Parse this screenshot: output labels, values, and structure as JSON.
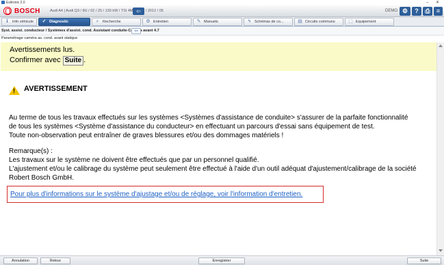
{
  "window": {
    "title": "Esitronic 2.0",
    "minimize_glyph": "–",
    "close_glyph": "✕"
  },
  "header": {
    "brand": "BOSCH",
    "vehicle_info": "Audi A4 | Audi Q3 / 8U / 02 / 25 / 130 kW / TSI 4M / 2019 / 2012 / 05",
    "back_glyph": "⇦",
    "demo_label": "DEMO",
    "buttons": [
      {
        "icon": "settings-icon",
        "glyph": "⚙"
      },
      {
        "icon": "help-icon",
        "glyph": "?"
      },
      {
        "icon": "print-icon",
        "glyph": "⎙"
      },
      {
        "icon": "menu-icon",
        "glyph": "≡"
      }
    ]
  },
  "tabs": [
    {
      "label": "Info véhicule",
      "icon": "info-icon",
      "glyph": "ℹ",
      "active": false
    },
    {
      "label": "Diagnostic",
      "icon": "diagnostic-icon",
      "glyph": "✓",
      "active": true
    },
    {
      "label": "Recherche",
      "icon": "search-icon",
      "glyph": "⌕",
      "active": false
    },
    {
      "label": "Entretien",
      "icon": "gears-icon",
      "glyph": "⚙",
      "active": false
    },
    {
      "label": "Manuels",
      "icon": "wrench-icon",
      "glyph": "✎",
      "active": false
    },
    {
      "label": "Schémas de co...",
      "icon": "lightning-icon",
      "glyph": "ϟ",
      "active": false
    },
    {
      "label": "Circuits communs",
      "icon": "folder-icon",
      "glyph": "▤",
      "active": false
    },
    {
      "label": "Equipement",
      "icon": "equipment-icon",
      "glyph": "⬚",
      "active": false
    }
  ],
  "breadcrumb": {
    "path": "Syst. assist. conducteur / Systèmes d'assist. cond. Assistant conduite-Caméra avant 4.7",
    "back_glyph": "⇦",
    "subtitle": "Paramétrage caméra as. cond. avant statique"
  },
  "notice": {
    "line1": "Avertissements lus.",
    "line2_prefix": "Confirmer avec ",
    "line2_key": "Suite",
    "line2_suffix": "."
  },
  "warning": {
    "title": "AVERTISSEMENT",
    "paragraph1": [
      "Au terme de tous les travaux effectués sur les systèmes <Systèmes d'assistance de conduite> s'assurer de la parfaite fonctionnalité",
      "de tous les systèmes <Système d'assistance du conducteur> en effectuant un parcours d'essai sans équipement de test.",
      "Toute non-observation peut entraîner de graves blessures et/ou des dommages matériels !"
    ],
    "remarks_heading": "Remarque(s) :",
    "paragraph2": [
      "Les travaux sur le système ne doivent être effectués que par un personnel qualifié.",
      "L'ajustement et/ou le calibrage du système peut seulement être effectué à l'aide d'un outil adéquat d'ajustement/calibrage de la société",
      "Robert Bosch GmbH."
    ]
  },
  "info_link": "Pour plus d'informations sur le système d'ajustage et/ou de réglage, voir l'information d'entretien.",
  "footer": {
    "cancel": "Annulation",
    "back": "Retour",
    "record": "Enregistrer",
    "next": "Suite"
  }
}
